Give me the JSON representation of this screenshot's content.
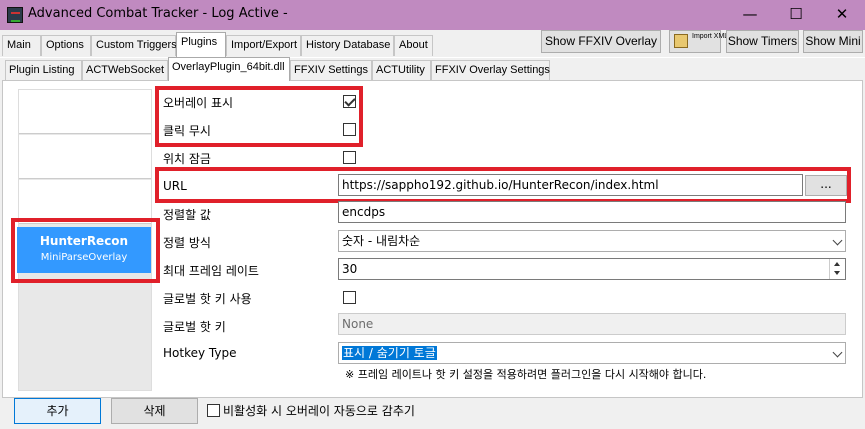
{
  "window": {
    "title": "Advanced Combat Tracker - Log Active -",
    "minimize_glyph": "—",
    "maximize_glyph": "☐",
    "close_glyph": "✕",
    "titlebar_color": "#c08ac0"
  },
  "menu_tabs": [
    "Main",
    "Options",
    "Custom Triggers",
    "Plugins",
    "Import/Export",
    "History Database",
    "About"
  ],
  "menu_tabs_active": "Plugins",
  "toolbar": {
    "show_ffxiv_overlay": "Show FFXIV Overlay",
    "import_xml": "Import XML",
    "show_timers": "Show Timers",
    "show_mini": "Show Mini"
  },
  "sub_tabs": [
    "Plugin Listing",
    "ACTWebSocket",
    "OverlayPlugin_64bit.dll",
    "FFXIV Settings",
    "ACTUtility",
    "FFXIV Overlay Settings"
  ],
  "sub_tabs_active": "OverlayPlugin_64bit.dll",
  "overlay_list": {
    "selected_name": "HunterRecon",
    "selected_type": "MiniParseOverlay",
    "selection_color": "#3399ff"
  },
  "settings": {
    "show_overlay": {
      "label": "오버레이 표시",
      "checked": true
    },
    "click_through": {
      "label": "클릭 무시",
      "checked": false
    },
    "lock_position": {
      "label": "위치 잠금",
      "checked": false
    },
    "url": {
      "label": "URL",
      "value": "https://sappho192.github.io/HunterRecon/index.html",
      "browse": "..."
    },
    "sort_key": {
      "label": "정렬할 값",
      "value": "encdps"
    },
    "sort_type": {
      "label": "정렬 방식",
      "value": "숫자 - 내림차순"
    },
    "max_frame_rate": {
      "label": "최대 프레임 레이트",
      "value": "30"
    },
    "global_hotkey_enabled": {
      "label": "글로벌 핫 키 사용",
      "checked": false
    },
    "global_hotkey": {
      "label": "글로벌 핫 키",
      "value": "None"
    },
    "hotkey_type": {
      "label": "Hotkey Type",
      "value": "표시 / 숨기기 토글"
    },
    "note": "※ 프레임 레이트나 핫 키 설정을 적용하려면 플러그인을 다시 시작해야 합니다."
  },
  "bottom": {
    "add_button": "추가",
    "delete_button": "삭제",
    "auto_hide_label": "비활성화 시 오버레이 자동으로 감추기",
    "auto_hide_checked": false
  },
  "highlight_color": "#e0202a"
}
